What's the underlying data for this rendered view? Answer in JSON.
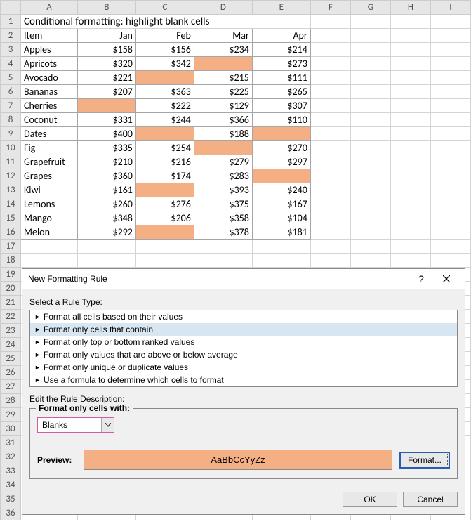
{
  "columns": [
    "A",
    "B",
    "C",
    "D",
    "E",
    "F",
    "G",
    "H",
    "I"
  ],
  "title": "Conditional formatting: highlight blank cells",
  "headers": {
    "item": "Item",
    "jan": "Jan",
    "feb": "Feb",
    "mar": "Mar",
    "apr": "Apr"
  },
  "rows": [
    {
      "item": "Apples",
      "jan": "$158",
      "feb": "$156",
      "mar": "$234",
      "apr": "$214"
    },
    {
      "item": "Apricots",
      "jan": "$320",
      "feb": "$342",
      "mar": "",
      "apr": "$273"
    },
    {
      "item": "Avocado",
      "jan": "$221",
      "feb": "",
      "mar": "$215",
      "apr": "$111"
    },
    {
      "item": "Bananas",
      "jan": "$207",
      "feb": "$363",
      "mar": "$225",
      "apr": "$265"
    },
    {
      "item": "Cherries",
      "jan": "",
      "feb": "$222",
      "mar": "$129",
      "apr": "$307"
    },
    {
      "item": "Coconut",
      "jan": "$331",
      "feb": "$244",
      "mar": "$366",
      "apr": "$110"
    },
    {
      "item": "Dates",
      "jan": "$400",
      "feb": "",
      "mar": "$188",
      "apr": ""
    },
    {
      "item": "Fig",
      "jan": "$335",
      "feb": "$254",
      "mar": "",
      "apr": "$270"
    },
    {
      "item": "Grapefruit",
      "jan": "$210",
      "feb": "$216",
      "mar": "$279",
      "apr": "$297"
    },
    {
      "item": "Grapes",
      "jan": "$360",
      "feb": "$174",
      "mar": "$283",
      "apr": ""
    },
    {
      "item": "Kiwi",
      "jan": "$161",
      "feb": "",
      "mar": "$393",
      "apr": "$240"
    },
    {
      "item": "Lemons",
      "jan": "$260",
      "feb": "$276",
      "mar": "$375",
      "apr": "$167"
    },
    {
      "item": "Mango",
      "jan": "$348",
      "feb": "$206",
      "mar": "$358",
      "apr": "$104"
    },
    {
      "item": "Melon",
      "jan": "$292",
      "feb": "",
      "mar": "$378",
      "apr": "$181"
    }
  ],
  "dialog": {
    "title": "New Formatting Rule",
    "help": "?",
    "select_label": "Select a Rule Type:",
    "rule_types": [
      "Format all cells based on their values",
      "Format only cells that contain",
      "Format only top or bottom ranked values",
      "Format only values that are above or below average",
      "Format only unique or duplicate values",
      "Use a formula to determine which cells to format"
    ],
    "selected_rule_index": 1,
    "edit_label": "Edit the Rule Description:",
    "format_only_label": "Format only cells with:",
    "combo_value": "Blanks",
    "preview_label": "Preview:",
    "preview_sample": "AaBbCcYyZz",
    "format_button": "Format...",
    "ok": "OK",
    "cancel": "Cancel"
  },
  "colors": {
    "highlight": "#f4b084"
  }
}
